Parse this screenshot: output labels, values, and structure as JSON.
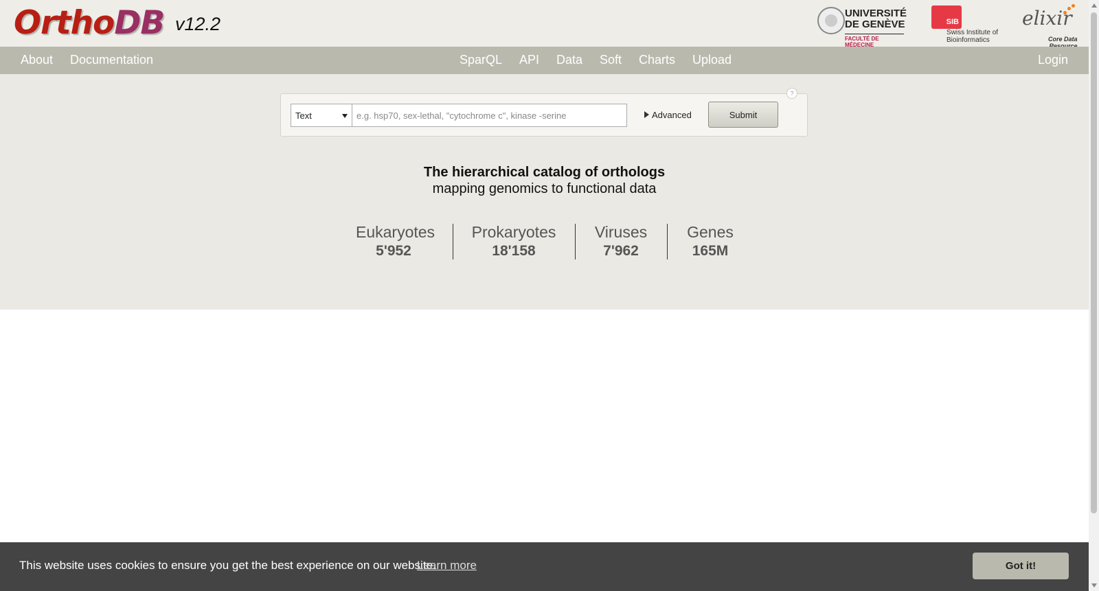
{
  "header": {
    "logo": {
      "part1": "Ortho",
      "part2": "DB"
    },
    "version": "v12.2",
    "partners": {
      "unige": {
        "line1": "UNIVERSITÉ",
        "line2": "DE GENÈVE",
        "line3": "FACULTÉ DE MÉDECINE"
      },
      "sib": {
        "box": "SIB",
        "line1": "Swiss Institute of",
        "line2": "Bioinformatics"
      },
      "elixir": {
        "name": "elixir",
        "line1": "Core Data",
        "line2": "Resource"
      }
    }
  },
  "nav": {
    "left": [
      "About",
      "Documentation"
    ],
    "center": [
      "SparQL",
      "API",
      "Data",
      "Soft",
      "Charts",
      "Upload"
    ],
    "right": "Login"
  },
  "search": {
    "mode": "Text",
    "placeholder": "e.g. hsp70, sex-lethal, \"cytochrome c\", kinase -serine",
    "advanced": "Advanced",
    "submit": "Submit",
    "help": "?"
  },
  "tagline": {
    "line1": "The hierarchical catalog of orthologs",
    "line2": "mapping genomics to functional data"
  },
  "stats": [
    {
      "label": "Eukaryotes",
      "value": "5'952"
    },
    {
      "label": "Prokaryotes",
      "value": "18'158"
    },
    {
      "label": "Viruses",
      "value": "7'962"
    },
    {
      "label": "Genes",
      "value": "165M"
    }
  ],
  "cookie": {
    "message": "This website uses cookies to ensure you get the best experience on our website.",
    "learn_more": "Learn more",
    "accept": "Got it!"
  }
}
